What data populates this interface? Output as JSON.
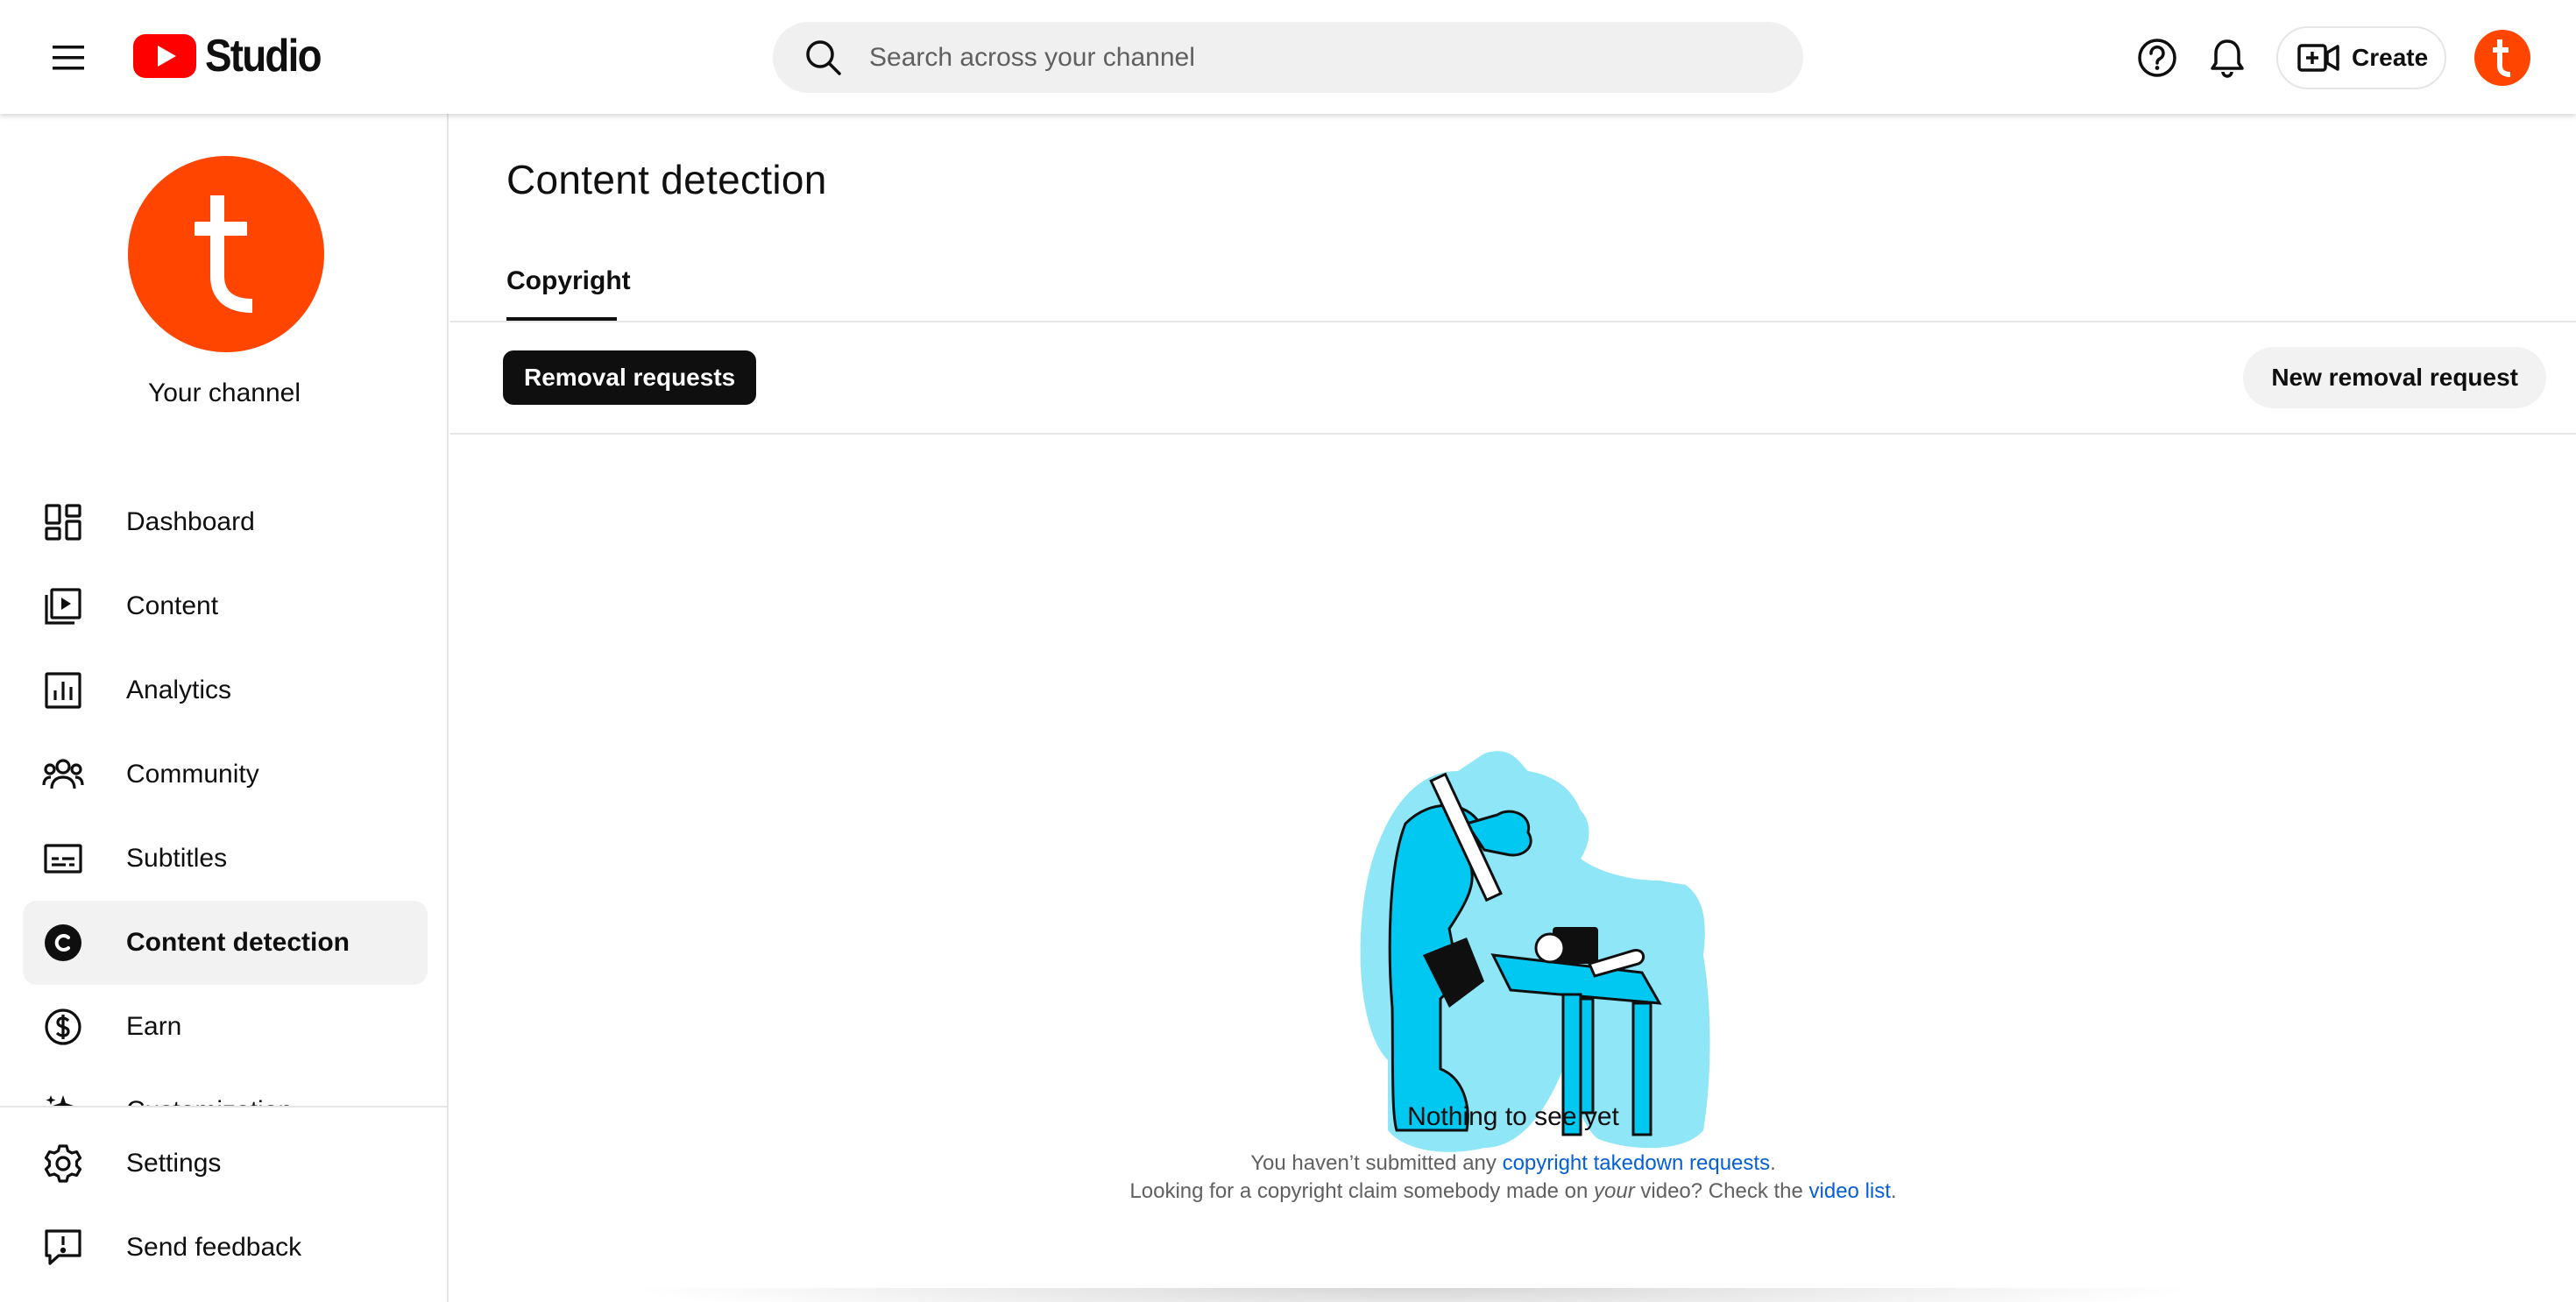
{
  "app": {
    "logo_text": "Studio",
    "brand_color": "#ff0000",
    "avatar_color": "#ff4500",
    "avatar_letter": "t"
  },
  "header": {
    "search_placeholder": "Search across your channel",
    "create_label": "Create",
    "icons": [
      "menu-icon",
      "youtube-logo",
      "search-icon",
      "help-icon",
      "bell-icon",
      "create-video-icon"
    ]
  },
  "sidebar": {
    "channel_name": "Your channel",
    "items": [
      {
        "label": "Dashboard",
        "icon": "dashboard-icon"
      },
      {
        "label": "Content",
        "icon": "content-icon"
      },
      {
        "label": "Analytics",
        "icon": "analytics-icon"
      },
      {
        "label": "Community",
        "icon": "community-icon"
      },
      {
        "label": "Subtitles",
        "icon": "subtitles-icon"
      },
      {
        "label": "Content detection",
        "icon": "copyright-icon",
        "active": true
      },
      {
        "label": "Earn",
        "icon": "dollar-icon"
      },
      {
        "label": "Customization",
        "icon": "sparkle-icon"
      }
    ],
    "bottom_items": [
      {
        "label": "Settings",
        "icon": "gear-icon"
      },
      {
        "label": "Send feedback",
        "icon": "feedback-icon"
      }
    ]
  },
  "main": {
    "title": "Content detection",
    "tab": "Copyright",
    "chip": "Removal requests",
    "new_request": "New removal request",
    "empty": {
      "title": "Nothing to see yet",
      "line1_prefix": "You haven’t submitted any ",
      "line1_link": "copyright takedown requests",
      "line1_suffix": ".",
      "line2_prefix": "Looking for a copyright claim somebody made on ",
      "line2_em": "your",
      "line2_mid": " video? Check the ",
      "line2_link": "video list",
      "line2_suffix": "."
    },
    "link_color": "#065fd4"
  }
}
